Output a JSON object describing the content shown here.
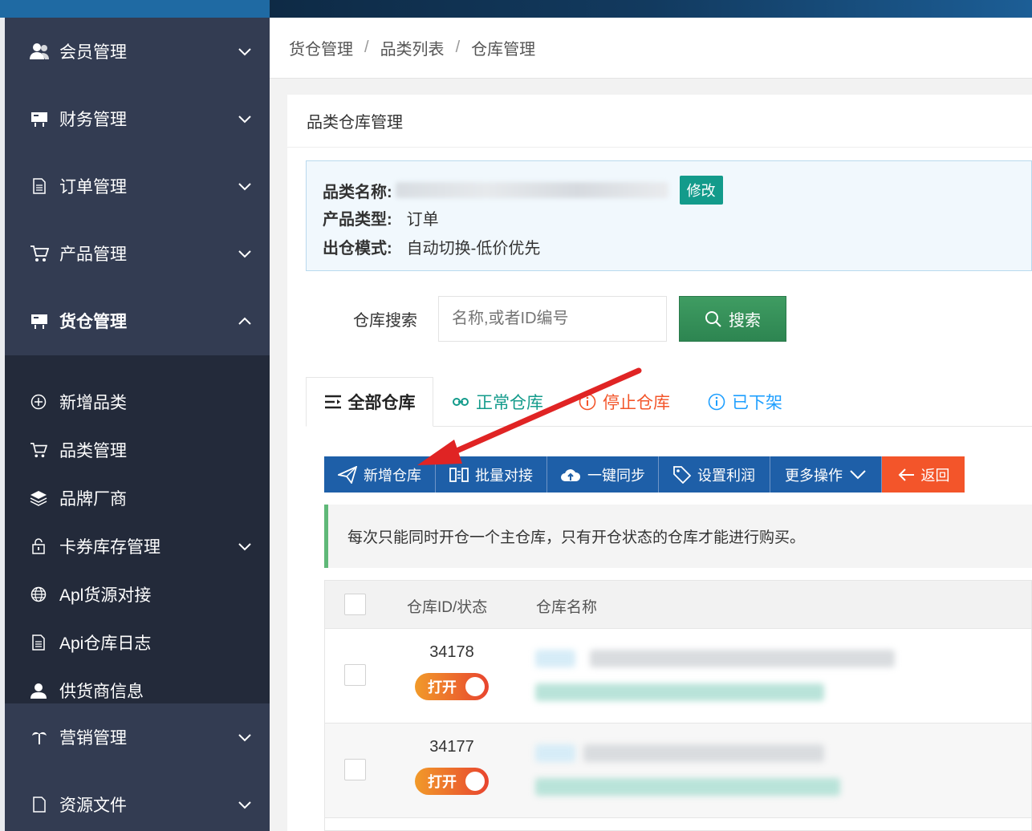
{
  "sidebar": {
    "items": [
      {
        "label": "会员管理",
        "icon": "users-icon"
      },
      {
        "label": "财务管理",
        "icon": "finance-icon"
      },
      {
        "label": "订单管理",
        "icon": "document-icon"
      },
      {
        "label": "产品管理",
        "icon": "cart-icon"
      },
      {
        "label": "货仓管理",
        "icon": "warehouse-icon"
      }
    ],
    "sub_items": [
      {
        "label": "新增品类",
        "icon": "plus-circle-icon"
      },
      {
        "label": "品类管理",
        "icon": "cart-icon"
      },
      {
        "label": "品牌厂商",
        "icon": "layers-icon"
      },
      {
        "label": "卡券库存管理",
        "icon": "lock-icon"
      },
      {
        "label": "Apl货源对接",
        "icon": "globe-icon"
      },
      {
        "label": "Api仓库日志",
        "icon": "document-icon"
      },
      {
        "label": "供货商信息",
        "icon": "user-icon"
      }
    ],
    "bottom_items": [
      {
        "label": "营销管理",
        "icon": "palm-icon"
      },
      {
        "label": "资源文件",
        "icon": "file-icon"
      }
    ]
  },
  "breadcrumb": [
    "货仓管理",
    "品类列表",
    "仓库管理"
  ],
  "breadcrumb_sep": "/",
  "card": {
    "title": "品类仓库管理",
    "info": {
      "name_key": "品类名称:",
      "edit_label": "修改",
      "type_key": "产品类型:",
      "type_value": "订单",
      "mode_key": "出仓模式:",
      "mode_value": "自动切换-低价优先"
    },
    "search": {
      "label": "仓库搜索",
      "placeholder": "名称,或者ID编号",
      "button": "搜索"
    },
    "tabs": [
      {
        "label": "全部仓库",
        "icon": "list-icon",
        "color": "#222222"
      },
      {
        "label": "正常仓库",
        "icon": "link-icon",
        "color": "#139b8b"
      },
      {
        "label": "停止仓库",
        "icon": "info-icon",
        "color": "#f3552a"
      },
      {
        "label": "已下架",
        "icon": "info-icon",
        "color": "#1e9fff"
      }
    ],
    "toolbar": [
      {
        "label": "新增仓库",
        "icon": "send-icon"
      },
      {
        "label": "批量对接",
        "icon": "columns-icon"
      },
      {
        "label": "一键同步",
        "icon": "cloud-upload-icon"
      },
      {
        "label": "设置利润",
        "icon": "tag-icon"
      },
      {
        "label": "更多操作",
        "icon": "chevron-down-icon"
      },
      {
        "label": "返回",
        "icon": "arrow-left-icon"
      }
    ],
    "notice": "每次只能同时开仓一个主仓库，只有开仓状态的仓库才能进行购买。",
    "table": {
      "headers": [
        "仓库ID/状态",
        "仓库名称"
      ],
      "rows": [
        {
          "id": "34178",
          "status": "打开"
        },
        {
          "id": "34177",
          "status": "打开"
        }
      ]
    }
  },
  "colors": {
    "accent": "#1e5fa8",
    "success": "#139b8b",
    "danger": "#f3552a",
    "sidebar": "#333c52",
    "annotation_arrow": "#e02424"
  }
}
